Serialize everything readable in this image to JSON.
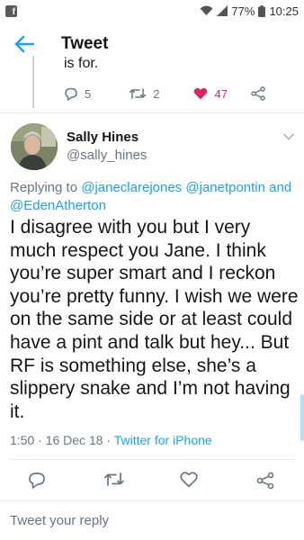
{
  "status_bar": {
    "notification_app": "f",
    "battery_text": "77%",
    "time": "10:25"
  },
  "header": {
    "title": "Tweet"
  },
  "previous_tweet": {
    "text_fragment": "is for.",
    "replies": "5",
    "retweets": "2",
    "likes": "47"
  },
  "tweet": {
    "author_name": "Sally Hines",
    "author_handle": "@sally_hines",
    "replying_prefix": "Replying to",
    "mentions": [
      "@janeclarejones",
      "@janetpontin",
      "and",
      "@EdenAtherton"
    ],
    "text": "I disagree with you but I very much respect you Jane. I think you’re super smart and I reckon you’re pretty funny. I wish we were on the same side or at least could have a pint and talk but hey... But RF is something else, she’s a slippery snake and I’m not having it.",
    "time": "1:50",
    "date": "16 Dec 18",
    "separator": "·",
    "source": "Twitter for iPhone"
  },
  "reply_box": {
    "placeholder": "Tweet your reply"
  },
  "colors": {
    "accent": "#1da1f2",
    "like": "#e0245e",
    "muted": "#657786",
    "divider": "#e1e8ed"
  }
}
